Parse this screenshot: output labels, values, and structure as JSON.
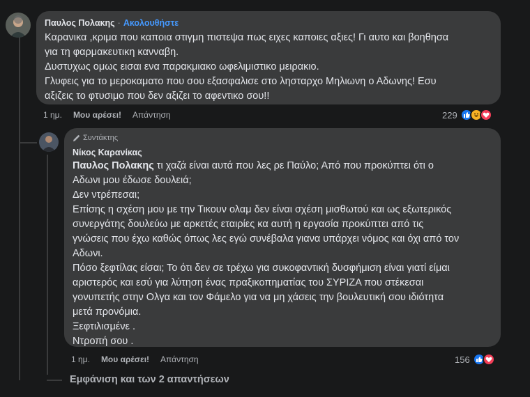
{
  "comment1": {
    "author": "Παυλος Πολακης",
    "separator": "·",
    "follow_label": "Ακολουθήστε",
    "lines": [
      "Καρανικα ,κριμα που καποια στιγμη πιστεψα πως ειχες καποιες αξιες! Γι αυτο και βοηθησα",
      "για τη φαρμακευτικη κανναβη.",
      "Δυστυχως ομως εισαι ενα παρακμιακο ωφελιμιστικο μειρακιο.",
      "Γλυφεις για το μεροκαματο που σου εξασφαλισε στο λησταρχο Μηλιωνη ο Αδωνης! Εσυ",
      "αξιζεις το φτυσιμο που δεν αξιζει το αφεντικο σου!!"
    ],
    "time": "1 ημ.",
    "like_label": "Μου αρέσει!",
    "reply_label": "Απάντηση",
    "reaction_count": "229",
    "reaction_icons": [
      "like-reaction",
      "haha-reaction",
      "love-reaction"
    ]
  },
  "comment2": {
    "badge": "Συντάκτης",
    "author": "Νίκος Καρανίκας",
    "mention": "Παυλος Πολακης",
    "first_line_rest": " τι χαζά είναι αυτά που λες ρε Παύλο; Από που προκύπτει ότι ο",
    "lines": [
      "Αδωνι μου έδωσε δουλειά;",
      "Δεν ντρέπεσαι;",
      "Επίσης η σχέση μου με την Τικουν ολαμ δεν είναι σχέση μισθωτού και ως εξωτερικός",
      "συνεργάτης δουλεύω με αρκετές εταιρίες κα αυτή η εργασία προκύπτει από τις",
      "γνώσεις που έχω καθώς όπως λες εγώ συνέβαλα γιανα υπάρχει νόμος και όχι από τον",
      "Αδωνι.",
      "Πόσο ξεφτίλας είσαι; Το ότι δεν σε τρέχω για συκοφαντική δυσφήμιση είναι γιατί είμαι",
      "αριστερός και εσύ για λύτηση ένας πραξικοπηματίας του ΣΥΡΙΖΑ που στέκεσαι",
      "γονυπετής στην Ολγα και τον Φάμελο για να μη χάσεις την βουλευτική σου ιδιότητα",
      "μετά προνόμια.",
      "Ξεφτιλισμένε .",
      "Ντροπή σου ."
    ],
    "time": "1 ημ.",
    "like_label": "Μου αρέσει!",
    "reply_label": "Απάντηση",
    "reaction_count": "156",
    "reaction_icons": [
      "like-reaction",
      "love-reaction"
    ]
  },
  "more_replies": "Εμφάνιση και των 2 απαντήσεων",
  "colors": {
    "background": "#18191a",
    "bubble": "#3a3b3c",
    "follow": "#4599ff",
    "like": "#1877f2",
    "love": "#f33e58",
    "haha": "#f7b125"
  }
}
